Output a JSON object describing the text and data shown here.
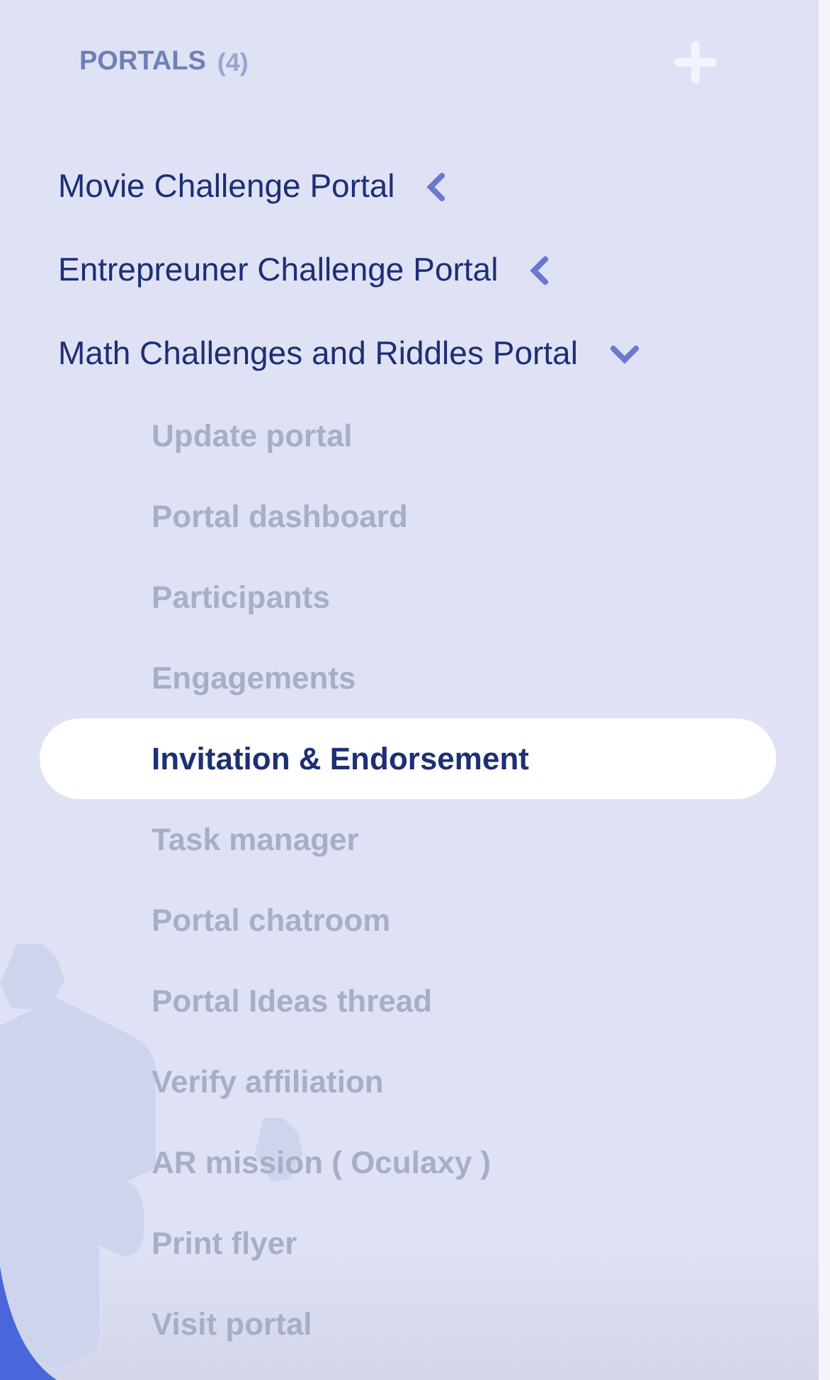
{
  "header": {
    "title": "PORTALS",
    "count": "(4)"
  },
  "portals": [
    {
      "name": "Movie Challenge Portal",
      "expanded": false
    },
    {
      "name": "Entrepreuner Challenge Portal",
      "expanded": false
    },
    {
      "name": "Math Challenges and Riddles Portal",
      "expanded": true,
      "children": [
        {
          "label": "Update portal",
          "selected": false
        },
        {
          "label": "Portal dashboard",
          "selected": false
        },
        {
          "label": "Participants",
          "selected": false
        },
        {
          "label": "Engagements",
          "selected": false
        },
        {
          "label": "Invitation & Endorsement",
          "selected": true
        },
        {
          "label": "Task manager",
          "selected": false
        },
        {
          "label": "Portal chatroom",
          "selected": false
        },
        {
          "label": "Portal Ideas thread",
          "selected": false
        },
        {
          "label": "Verify affiliation",
          "selected": false
        },
        {
          "label": "AR mission ( Oculaxy )",
          "selected": false
        },
        {
          "label": "Print flyer",
          "selected": false
        },
        {
          "label": "Visit portal",
          "selected": false
        }
      ]
    }
  ]
}
